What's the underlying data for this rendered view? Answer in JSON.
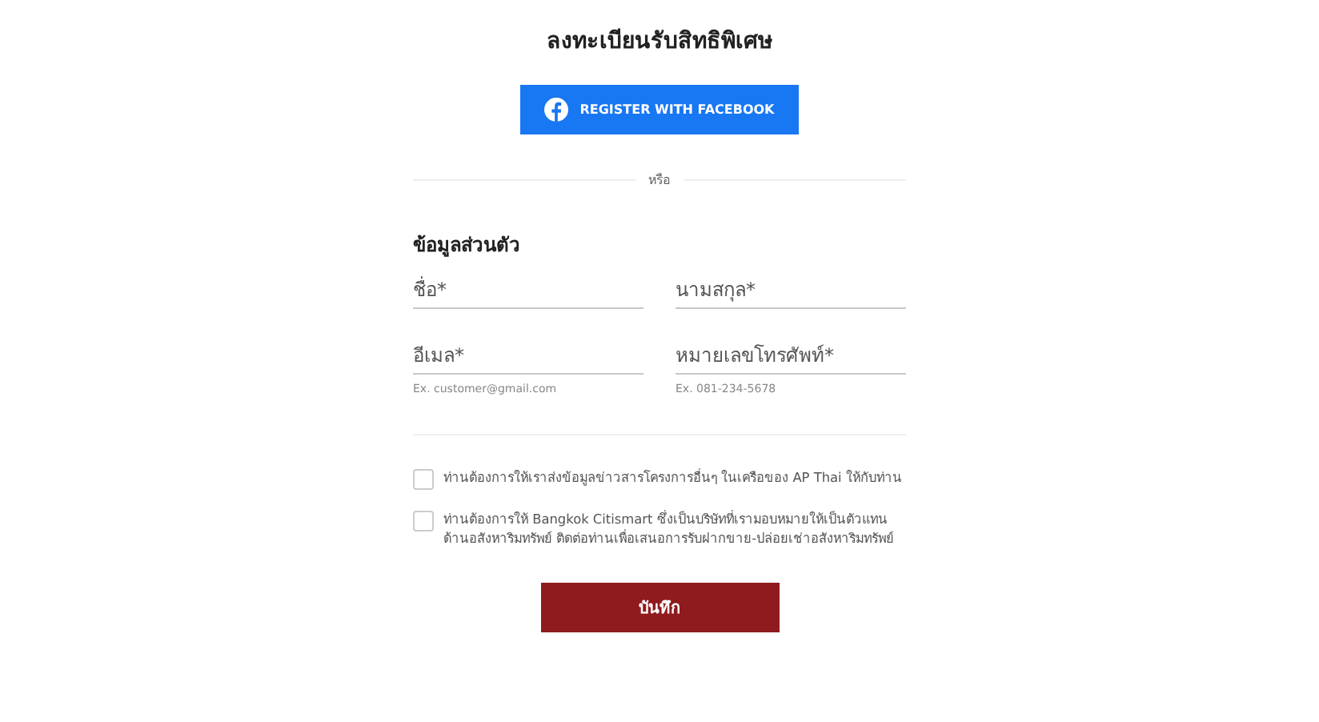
{
  "title": "ลงทะเบียนรับสิทธิพิเศษ",
  "facebook_button": {
    "label": "REGISTER WITH FACEBOOK"
  },
  "divider_label": "หรือ",
  "section_title": "ข้อมูลส่วนตัว",
  "fields": [
    {
      "placeholder": "ชื่อ*"
    },
    {
      "placeholder": "นามสกุล*"
    },
    {
      "placeholder": "อีเมล*",
      "hint": "Ex. customer@gmail.com"
    },
    {
      "placeholder": "หมายเลขโทรศัพท์*",
      "hint": "Ex. 081-234-5678"
    }
  ],
  "consents": [
    {
      "label": "ท่านต้องการให้เราส่งข้อมูลข่าวสารโครงการอื่นๆ ในเครือของ AP Thai ให้กับท่าน",
      "checked": false
    },
    {
      "label": "ท่านต้องการให้ Bangkok Citismart ซึ่งเป็นบริษัทที่เรามอบหมายให้เป็นตัวแทนด้านอสังหาริมทรัพย์ ติดต่อท่านเพื่อเสนอการรับฝากขาย-ปล่อยเช่าอสังหาริมทรัพย์",
      "checked": false
    }
  ],
  "save_button": {
    "label": "บันทึก"
  }
}
